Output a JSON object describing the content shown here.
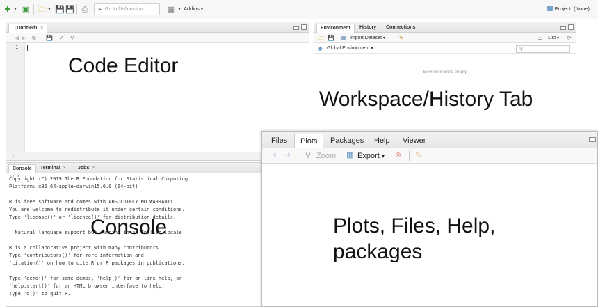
{
  "toolbar": {
    "goto_placeholder": "Go to file/function",
    "addins_label": "Addins",
    "project_label": "Project: (None)"
  },
  "editor": {
    "tab_label": "Untitled1",
    "line_number": "1",
    "status_position": "1:1"
  },
  "environment": {
    "tabs": [
      "Environment",
      "History",
      "Connections"
    ],
    "import_label": "Import Dataset",
    "list_label": "List",
    "scope_label": "Global Environment",
    "empty_message": "Environment is empty"
  },
  "console": {
    "tabs": [
      "Console",
      "Terminal",
      "Jobs"
    ],
    "path": "~/",
    "lines": [
      "Copyright (C) 2019 The R Foundation for Statistical Computing",
      "Platform: x86_64-apple-darwin15.6.0 (64-bit)",
      "",
      "R is free software and comes with ABSOLUTELY NO WARRANTY.",
      "You are welcome to redistribute it under certain conditions.",
      "Type 'license()' or 'licence()' for distribution details.",
      "",
      "  Natural language support but running in an English locale",
      "",
      "R is a collaborative project with many contributors.",
      "Type 'contributors()' for more information and",
      "'citation()' on how to cite R or R packages in publications.",
      "",
      "Type 'demo()' for some demos, 'help()' for on-line help, or",
      "'help.start()' for an HTML browser interface to help.",
      "Type 'q()' to quit R."
    ]
  },
  "plots": {
    "tabs": [
      "Files",
      "Plots",
      "Packages",
      "Help",
      "Viewer"
    ],
    "zoom_label": "Zoom",
    "export_label": "Export"
  },
  "overlay_labels": {
    "code_editor": "Code Editor",
    "workspace": "Workspace/History Tab",
    "console": "Console",
    "plots": "Plots, Files, Help, packages"
  }
}
